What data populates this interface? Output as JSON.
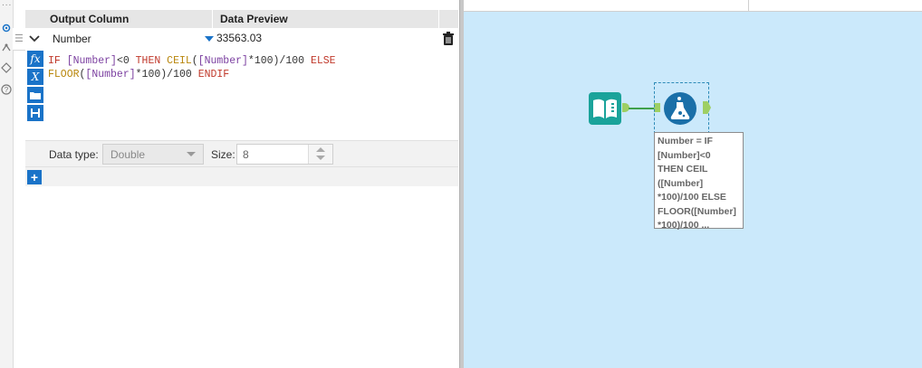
{
  "window": {
    "left_strip_dots": "...",
    "left_strip_icons": [
      "gear-icon",
      "dependency-icon",
      "tag-icon",
      "help-icon"
    ]
  },
  "grid": {
    "headers": {
      "output_column": "Output Column",
      "data_preview": "Data Preview"
    },
    "row": {
      "output_column_value": "Number",
      "data_preview_value": "33563.03",
      "delete_icon": "trash-icon"
    }
  },
  "expression": {
    "line1": [
      {
        "t": "IF ",
        "c": "kw"
      },
      {
        "t": "[Number]",
        "c": "fld"
      },
      {
        "t": "<0 ",
        "c": "op"
      },
      {
        "t": "THEN ",
        "c": "kw"
      },
      {
        "t": "CEIL",
        "c": "fn"
      },
      {
        "t": "(",
        "c": "op"
      },
      {
        "t": "[Number]",
        "c": "fld"
      },
      {
        "t": "*",
        "c": "op"
      },
      {
        "t": "100",
        "c": "num"
      },
      {
        "t": ")/100 ",
        "c": "op"
      },
      {
        "t": "ELSE",
        "c": "kw"
      }
    ],
    "line2": [
      {
        "t": "FLOOR",
        "c": "fn"
      },
      {
        "t": "(",
        "c": "op"
      },
      {
        "t": "[Number]",
        "c": "fld"
      },
      {
        "t": "*",
        "c": "op"
      },
      {
        "t": "100",
        "c": "num"
      },
      {
        "t": ")/100 ",
        "c": "op"
      },
      {
        "t": "ENDIF",
        "c": "kw"
      }
    ],
    "tool_buttons": [
      {
        "name": "function-icon",
        "glyph": "fx"
      },
      {
        "name": "variable-icon",
        "glyph": "X"
      },
      {
        "name": "open-folder-icon",
        "glyph": ""
      },
      {
        "name": "save-icon",
        "glyph": ""
      }
    ]
  },
  "field_settings": {
    "data_type_label": "Data type:",
    "data_type_value": "Double",
    "size_label": "Size:",
    "size_value": "8"
  },
  "add_button": {
    "label": "+"
  },
  "canvas": {
    "colors": {
      "background": "#cbe9fb",
      "input_tool": "#1aa39a",
      "formula_tool": "#1a6fa8",
      "connector": "#3fa04a",
      "anchor": "#9ecf63"
    },
    "annotation": "Number = IF\n[Number]<0\nTHEN CEIL\n([Number]\n*100)/100 ELSE\nFLOOR([Number]\n*100)/100 ..."
  }
}
